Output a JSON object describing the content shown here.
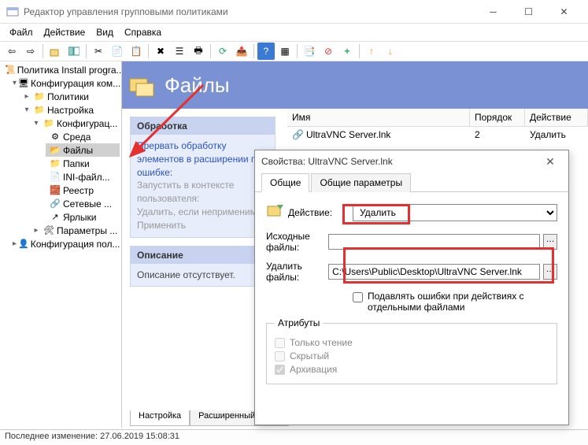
{
  "window": {
    "title": "Редактор управления групповыми политиками",
    "menu": [
      "Файл",
      "Действие",
      "Вид",
      "Справка"
    ]
  },
  "tree": {
    "root": "Политика Install progra...",
    "items": [
      "Конфигурация ком...",
      "Политики",
      "Настройка",
      "Конфигурац...",
      "Среда",
      "Файлы",
      "Папки",
      "INI-файл...",
      "Реестр",
      "Сетевые ...",
      "Ярлыки",
      "Параметры ...",
      "Конфигурация пол..."
    ]
  },
  "header": {
    "title": "Файлы"
  },
  "processing": {
    "title": "Обработка",
    "stop_label": "Прервать обработку элементов в расширении при ошибке:",
    "run_ctx": "Запустить в контексте пользователя:",
    "remove": "Удалить, если неприменимо:",
    "apply": "Применить"
  },
  "description": {
    "title": "Описание",
    "body": "Описание отсутствует."
  },
  "list": {
    "cols": [
      "Имя",
      "Порядок",
      "Действие"
    ],
    "row": {
      "name": "UltraVNC Server.lnk",
      "order": "2",
      "action": "Удалить"
    }
  },
  "bottom_tabs": {
    "t1": "Настройка",
    "t2": "Расширенный"
  },
  "statusbar": "Последнее изменение: 27.06.2019 15:08:31",
  "dialog": {
    "title": "Свойства: UltraVNC Server.lnk",
    "tabs": [
      "Общие",
      "Общие параметры"
    ],
    "action_label": "Действие:",
    "action_value": "Удалить",
    "source_label": "Исходные файлы:",
    "source_value": "",
    "delete_label": "Удалить файлы:",
    "delete_value": "C:\\Users\\Public\\Desktop\\UltraVNC Server.lnk",
    "suppress": "Подавлять ошибки при действиях с отдельными файлами",
    "attrs_legend": "Атрибуты",
    "attr_ro": "Только чтение",
    "attr_hidden": "Скрытый",
    "attr_archive": "Архивация"
  }
}
